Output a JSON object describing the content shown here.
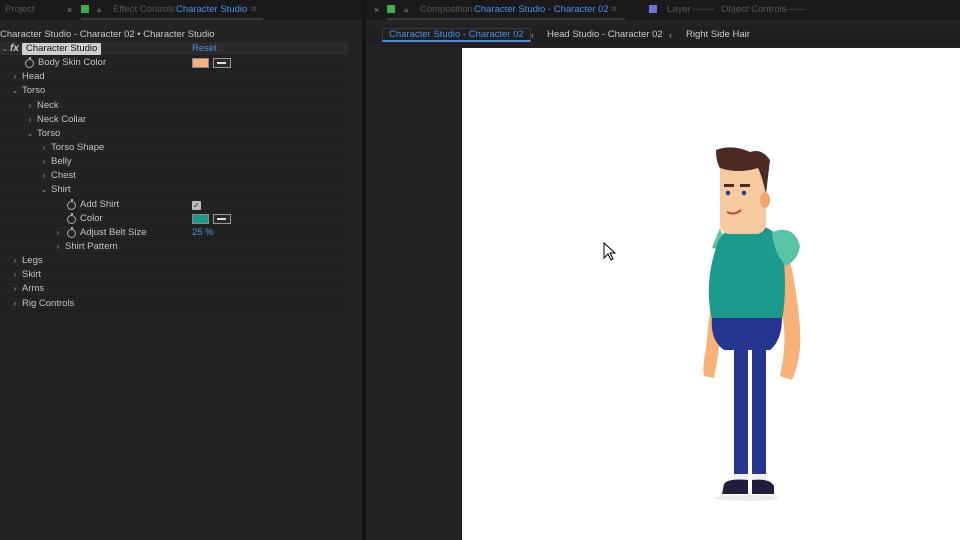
{
  "left_panel": {
    "tabs": {
      "project": "Project",
      "close": "×",
      "effect_controls_prefix": "Effect Controls",
      "effect_controls_target": "Character Studio",
      "menu": "≡"
    },
    "subtitle": "Character Studio - Character 02 • Character Studio",
    "effect_name": "Character Studio",
    "reset_label": "Reset",
    "rows": [
      {
        "label": "Body Skin Color"
      },
      {
        "label": "Head"
      },
      {
        "label": "Torso"
      },
      {
        "label": "Neck"
      },
      {
        "label": "Neck Collar"
      },
      {
        "label": "Torso"
      },
      {
        "label": "Torso Shape"
      },
      {
        "label": "Belly"
      },
      {
        "label": "Chest"
      },
      {
        "label": "Shirt"
      },
      {
        "label": "Add Shirt"
      },
      {
        "label": "Color"
      },
      {
        "label": "Adjust Belt Size",
        "value": "25 %"
      },
      {
        "label": "Shirt Pattern"
      },
      {
        "label": "Legs"
      },
      {
        "label": "Skirt"
      },
      {
        "label": "Arms"
      },
      {
        "label": "Rig Controls"
      }
    ],
    "add_shirt_checked": true,
    "colors": {
      "body_skin": "#f7b27a",
      "shirt": "#1a9a8c"
    }
  },
  "right_panel": {
    "tabs": {
      "close": "×",
      "composition_prefix": "Composition",
      "composition_target": "Character Studio - Character 02",
      "menu": "≡",
      "layer_prefix": "Layer",
      "layer_value": "-------",
      "object_controls": "Object Controls",
      "object_controls_suffix": "-------"
    },
    "breadcrumbs": [
      "Character Studio - Character 02",
      "Head Studio - Character 02",
      "Right Side Hair"
    ],
    "canvas_background": "#ffffff"
  },
  "accent_color": "#4a8fe0"
}
